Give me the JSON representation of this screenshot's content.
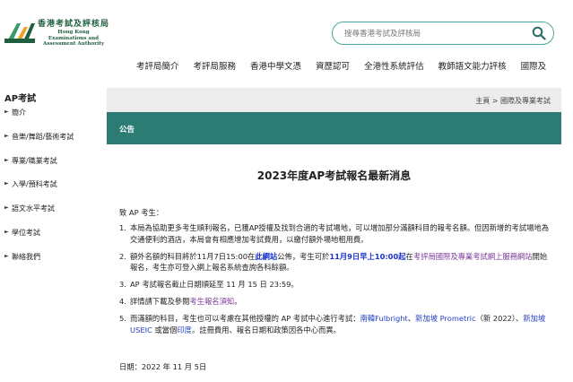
{
  "header": {
    "logo_cn": "香港考試及評核局",
    "logo_en_lines": [
      "Hong Kong",
      "Examinations and",
      "Assessment Authority"
    ],
    "search_placeholder": "搜尋香港考試及評核局"
  },
  "topnav": [
    "考評局簡介",
    "考評局服務",
    "香港中學文憑",
    "資歷認可",
    "全港性系統評估",
    "教師語文能力評核",
    "國際及"
  ],
  "sidebar": {
    "title": "AP考試",
    "items": [
      "簡介",
      "音樂/舞蹈/藝術考試",
      "專業/職業考試",
      "入學/預科考試",
      "語文水平考試",
      "學位考試",
      "聯絡我們"
    ]
  },
  "breadcrumb": "主頁 > 國際及專業考試",
  "band_label": "公告",
  "article": {
    "title": "2023年度AP考試報名最新消息",
    "greeting": "致 AP 考生：",
    "items": [
      {
        "num": "1.",
        "text": "本局為協助更多考生順利報名，已獲AP授權及找到合適的考試場地，可以增加部分滿額科目的報考名額。但因新增的考試場地為交通便利的酒店，本局會有相應增加考試費用，以繳付額外場地租用費。"
      },
      {
        "num": "2.",
        "a": "額外名額的科目將於11月7日15:00在",
        "a_link": "此網站",
        "b": "公佈，考生可於",
        "b_bold": "11月9日早上10:00起",
        "c": "在",
        "c_link": "考評局國際及專業考試網上服務網站",
        "d": "開始報名，考生亦可登入網上報名系統查詢各科餘額。"
      },
      {
        "num": "3.",
        "text": "AP 考試報名截止日期順延至 11 月 15 日 23:59。"
      },
      {
        "num": "4.",
        "a": "詳情請下載及參閱",
        "a_link": "考生報名須知",
        "b": "。"
      },
      {
        "num": "5.",
        "a": "而滿額的科目，考生也可以考慮在其他授權的 AP 考試中心進行考試：",
        "link1": "南韓Fulbright",
        "sep1": "、",
        "link2": "新加坡 Prometric",
        "b": "（新 2022）、",
        "link3": "新加坡 USEIC",
        "c": " 或當個",
        "link4": "印度",
        "d": "。註冊費用、報名日期和政策因各中心而異。"
      }
    ],
    "date": "日期：2022 年 11 月 5日"
  },
  "colors": {
    "teal_band": "#2d7c74",
    "search_border": "#4aa79d",
    "logo_green": "#1f5f3f",
    "link_purple": "#7a3a9a",
    "link_blue": "#2440c4"
  }
}
